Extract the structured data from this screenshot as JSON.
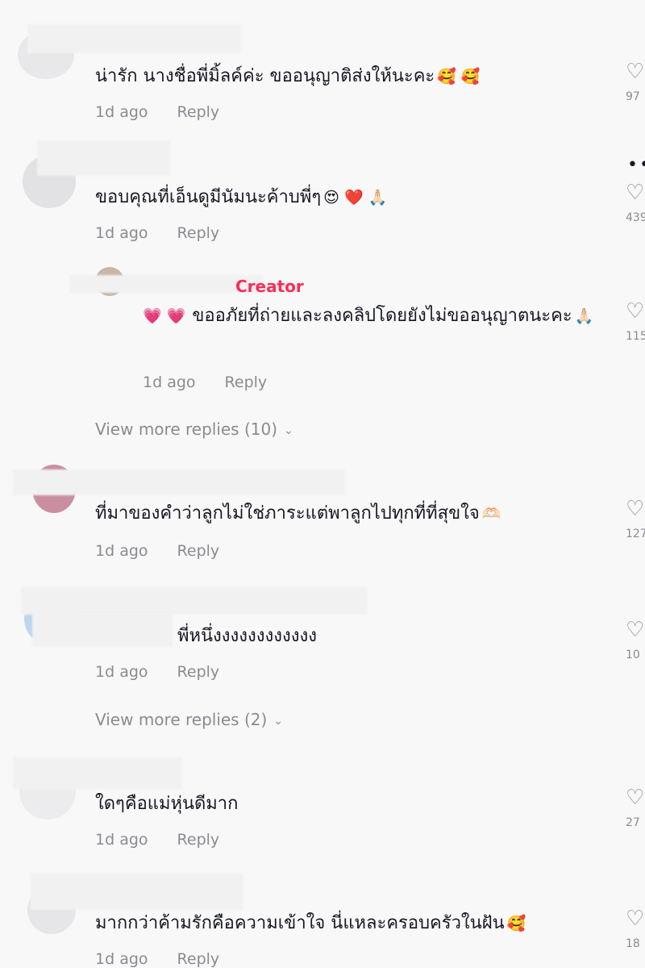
{
  "colors": {
    "background": "#f8f8f8",
    "text": "#161823",
    "muted": "#8a8b91",
    "creator_accent": "#fe2c55"
  },
  "comments": [
    {
      "text": "น่ารัก นางชื่อพี่มิ้ลค์ค่ะ ขออนุญาติส่งให้นะคะ",
      "emoji": "🥰 🥰",
      "time": "1d ago",
      "reply": "Reply",
      "likes": "97"
    },
    {
      "text": "ขอบคุณที่เอ็นดูมีนัมนะค้าบพี่ๆ",
      "emoji": "😍 ❤️ 🙏🏻",
      "time": "1d ago",
      "reply": "Reply",
      "likes": "439"
    },
    {
      "text": "ขออภัยที่ถ่ายและลงคลิปโดยยังไม่ขออนุญาตนะคะ",
      "emoji_prefix": "💗 💗",
      "emoji": "🙏🏻",
      "creator": "Creator",
      "time": "1d ago",
      "reply": "Reply",
      "likes": "115"
    },
    {
      "text": "ที่มาของคำว่าลูกไม่ใช่ภาระแต่พาลูกไปทุกที่ที่สุขใจ",
      "emoji": "🫶🏻",
      "time": "1d ago",
      "reply": "Reply",
      "likes": "127"
    },
    {
      "text": "พี่หนึ่งงงงงงงงงงงง",
      "time": "1d ago",
      "reply": "Reply",
      "likes": "10"
    },
    {
      "text": "ใดๆคือแม่หุ่นดีมาก",
      "time": "1d ago",
      "reply": "Reply",
      "likes": "27"
    },
    {
      "text": "มากกว่าค้ามรักคือความเข้าใจ นี่แหละครอบครัวในฝัน",
      "emoji": "🥰",
      "time": "1d ago",
      "reply": "Reply",
      "likes": "18"
    }
  ],
  "view_more": [
    {
      "label": "View more replies (10)"
    },
    {
      "label": "View more replies (2)"
    }
  ],
  "icons": {
    "like": "heart-outline-icon",
    "more": "more-dots-icon",
    "chevron": "chevron-down-icon"
  }
}
